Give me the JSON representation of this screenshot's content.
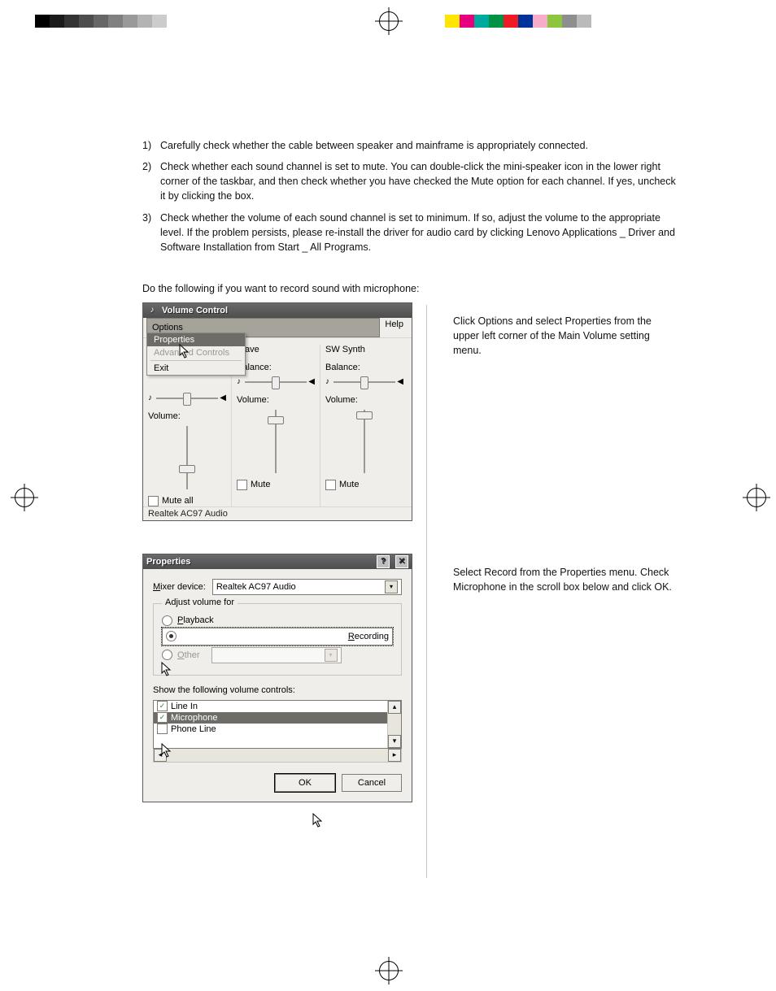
{
  "steps": [
    {
      "n": "1)",
      "t": "Carefully check whether the cable between speaker and mainframe is appropriately connected."
    },
    {
      "n": "2)",
      "t": "Check whether each sound channel is set to mute. You can double-click the mini-speaker icon in the lower right corner of the taskbar, and then check whether you have checked the Mute option for each channel. If yes, uncheck it by clicking the box."
    },
    {
      "n": "3)",
      "t": "Check whether the volume of each sound channel is set to minimum. If so, adjust the volume to the appropriate level. If the problem persists, please re-install the driver for audio card by clicking Lenovo Applications _ Driver and Software Installation from Start _ All Programs."
    }
  ],
  "lead": "Do the following if you want to record sound with microphone:",
  "caption1": "Click Options and select Properties from the upper left corner of the Main Volume setting menu.",
  "caption2": "Select Record from the Properties menu. Check Microphone in the scroll box below and click OK.",
  "volctrl": {
    "title": "Volume Control",
    "menu": {
      "options": "Options",
      "help": "Help"
    },
    "drop": {
      "properties": "Properties",
      "adv": "Advanced Controls",
      "exit": "Exit"
    },
    "balance": "Balance:",
    "volume": "Volume:",
    "muteall": "Mute all",
    "mute": "Mute",
    "ch0": "",
    "ch1": "Wave",
    "ch2": "SW Synth",
    "status": "Realtek AC97 Audio"
  },
  "props": {
    "title": "Properties",
    "mixer_label": "Mixer device:",
    "mixer_value": "Realtek AC97 Audio",
    "group": "Adjust volume for",
    "playback": "Playback",
    "recording": "Recording",
    "other": "Other",
    "showlabel": "Show the following volume controls:",
    "items": {
      "linein": "Line In",
      "mic": "Microphone",
      "phone": "Phone Line"
    },
    "ok": "OK",
    "cancel": "Cancel"
  },
  "colorbars": {
    "left": [
      "#000",
      "#1a1a1a",
      "#333",
      "#4d4d4d",
      "#666",
      "#808080",
      "#999",
      "#b3b3b3",
      "#ccc",
      "#fff"
    ],
    "right": [
      "#ffe600",
      "#e6007e",
      "#00a99d",
      "#009245",
      "#ed1c24",
      "#003399",
      "#f7adc9",
      "#8cc63f",
      "#8e8e8e",
      "#bababa"
    ]
  }
}
